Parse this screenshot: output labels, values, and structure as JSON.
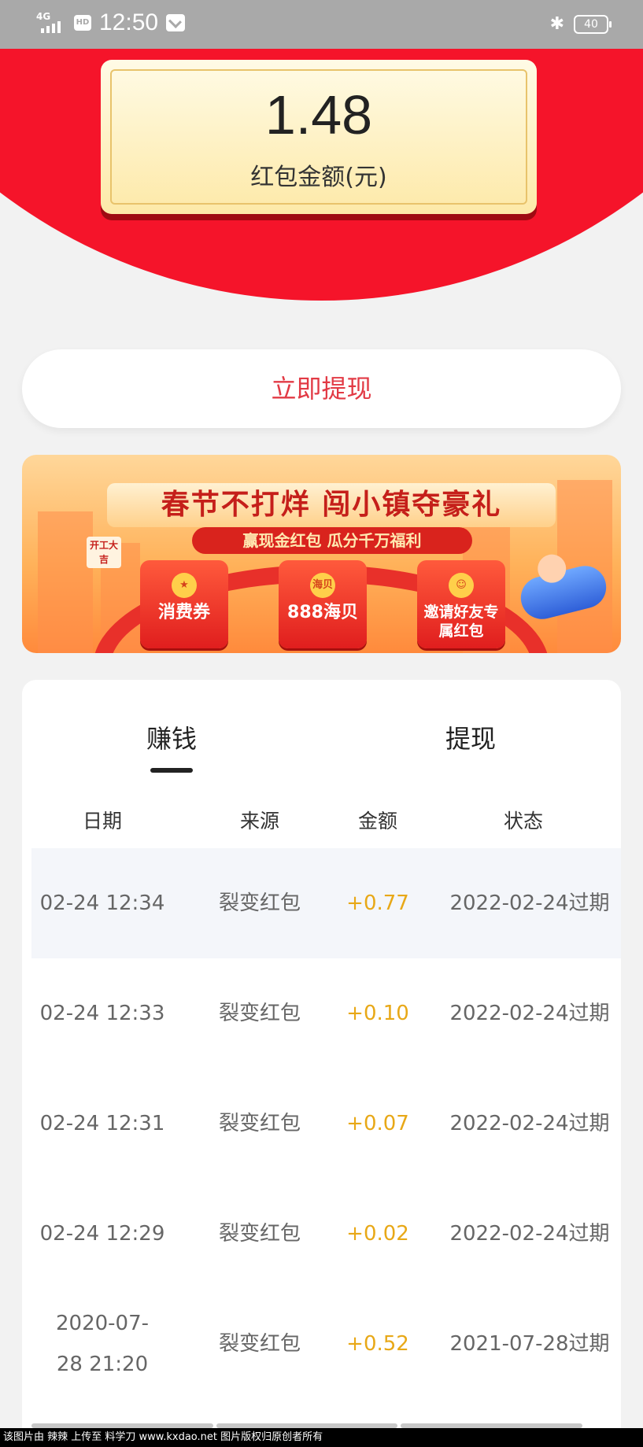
{
  "status_bar": {
    "network": "4G",
    "hd": "HD",
    "time": "12:50",
    "battery": "40"
  },
  "balance": {
    "amount": "1.48",
    "label": "红包金额(元)"
  },
  "withdraw_button": "立即提现",
  "banner": {
    "title": "春节不打烊 闯小镇夺豪礼",
    "subtitle": "赢现金红包 瓜分千万福利",
    "badge": "开工大吉",
    "envelopes": [
      {
        "label": "消费券",
        "coin": "★"
      },
      {
        "label": "888海贝",
        "coin": "海贝"
      },
      {
        "label": "邀请好友专属红包",
        "coin": "☺"
      }
    ]
  },
  "tabs": [
    {
      "label": "赚钱",
      "active": true
    },
    {
      "label": "提现",
      "active": false
    }
  ],
  "table": {
    "headers": [
      "日期",
      "来源",
      "金额",
      "状态"
    ],
    "rows": [
      {
        "date": "02-24 12:34",
        "source": "裂变红包",
        "amount": "+0.77",
        "status": "2022-02-24过期"
      },
      {
        "date": "02-24 12:33",
        "source": "裂变红包",
        "amount": "+0.10",
        "status": "2022-02-24过期"
      },
      {
        "date": "02-24 12:31",
        "source": "裂变红包",
        "amount": "+0.07",
        "status": "2022-02-24过期"
      },
      {
        "date": "02-24 12:29",
        "source": "裂变红包",
        "amount": "+0.02",
        "status": "2022-02-24过期"
      },
      {
        "date": "2020-07-28 21:20",
        "source": "裂变红包",
        "amount": "+0.52",
        "status": "2021-07-28过期"
      }
    ]
  },
  "watermark": "该图片由 辣辣 上传至 料学刀 www.kxdao.net 图片版权归原创者所有",
  "colors": {
    "header_red": "#f5142a",
    "accent_red": "#e23a45",
    "amount_gold": "#e8a817"
  }
}
